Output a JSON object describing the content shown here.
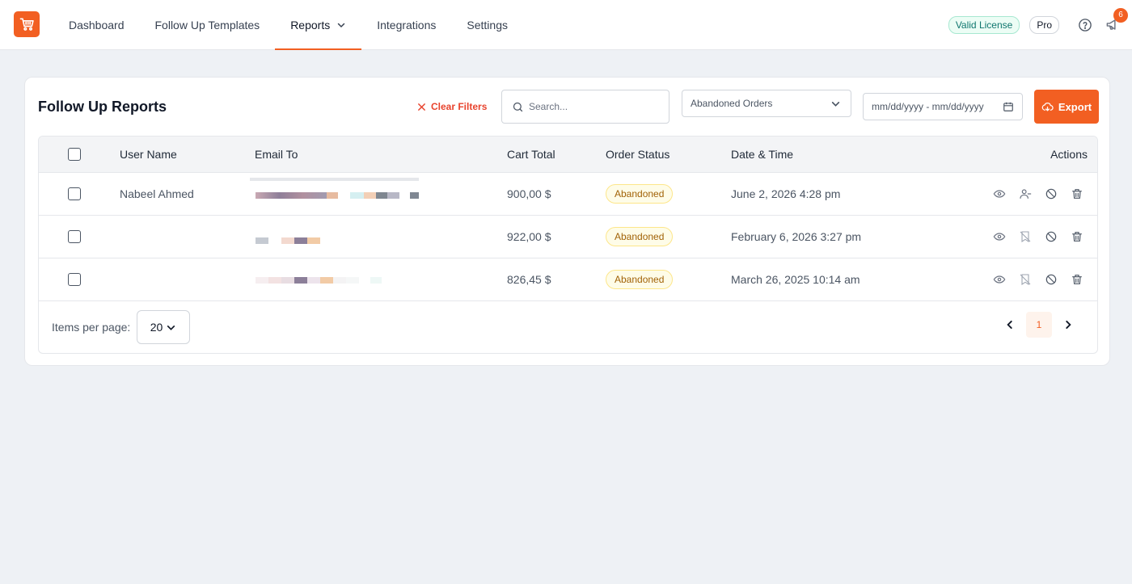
{
  "nav": {
    "items": [
      {
        "label": "Dashboard",
        "active": false,
        "has_dropdown": false
      },
      {
        "label": "Follow Up Templates",
        "active": false,
        "has_dropdown": false
      },
      {
        "label": "Reports",
        "active": true,
        "has_dropdown": true
      },
      {
        "label": "Integrations",
        "active": false,
        "has_dropdown": false
      },
      {
        "label": "Settings",
        "active": false,
        "has_dropdown": false
      }
    ],
    "license_badge": "Valid License",
    "plan_badge": "Pro",
    "notification_count": "6",
    "icons": [
      "cart-logo-icon",
      "help-icon",
      "megaphone-icon"
    ]
  },
  "card": {
    "title": "Follow Up Reports",
    "clear_filters": "Clear Filters",
    "search_placeholder": "Search...",
    "type_filter": "Abandoned Orders",
    "date_placeholder": "mm/dd/yyyy - mm/dd/yyyy",
    "export_label": "Export"
  },
  "table": {
    "columns": [
      "User Name",
      "Email To",
      "Cart Total",
      "Order Status",
      "Date & Time",
      "Actions"
    ],
    "rows": [
      {
        "user": "Nabeel Ahmed",
        "total": "900,00 $",
        "status": "Abandoned",
        "date": "June 2, 2026 4:28 pm"
      },
      {
        "user": "",
        "total": "922,00 $",
        "status": "Abandoned",
        "date": "February 6, 2026 3:27 pm"
      },
      {
        "user": "",
        "total": "826,45 $",
        "status": "Abandoned",
        "date": "March 26, 2025 10:14 am"
      }
    ],
    "items_per_page_label": "Items per page:",
    "items_per_page": "20",
    "current_page": "1"
  },
  "colors": {
    "accent": "#f25f22",
    "danger": "#e8432d",
    "status_bg": "#fefce8",
    "status_text": "#a16207"
  }
}
